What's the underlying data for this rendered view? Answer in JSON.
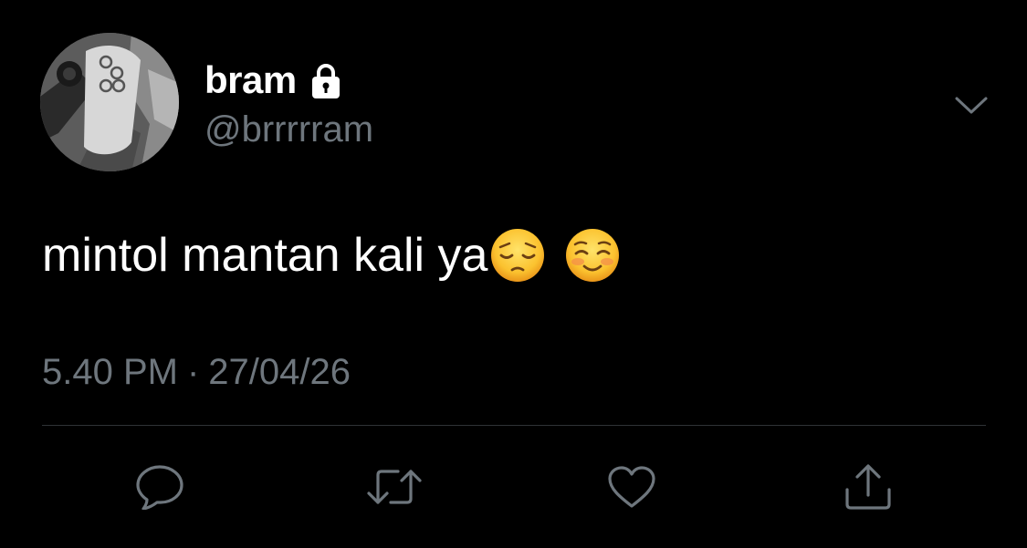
{
  "user": {
    "display_name": "bram",
    "handle": "@brrrrram",
    "protected_icon": "lock-icon",
    "avatar_icon": "game-controller-photo"
  },
  "tweet": {
    "text": "mintol mantan kali ya",
    "emojis": [
      "pensive-face-emoji",
      "smiling-face-emoji"
    ],
    "time": "5.40 PM",
    "separator": "·",
    "date": "27/04/26"
  },
  "actions": {
    "reply_icon": "reply-icon",
    "retweet_icon": "retweet-icon",
    "like_icon": "heart-icon",
    "share_icon": "share-icon"
  },
  "colors": {
    "background": "#000000",
    "text_primary": "#ffffff",
    "text_secondary": "#6e767d",
    "divider": "#2f3336"
  }
}
